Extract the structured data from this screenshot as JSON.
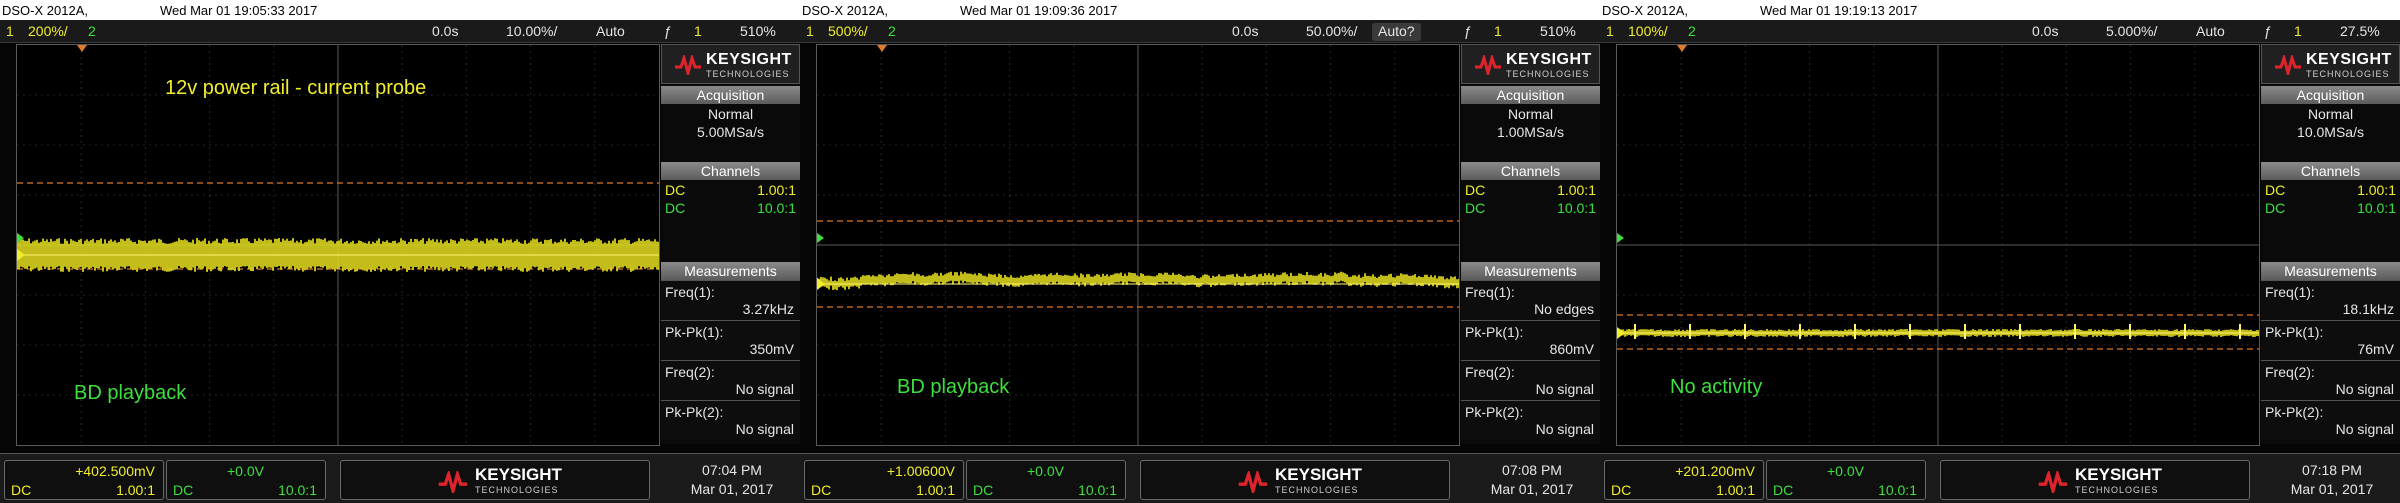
{
  "colors": {
    "ch1": "#f2ee2c",
    "ch2": "#3ce03c",
    "cursor": "#e07a2a",
    "keysight_red": "#e0242c"
  },
  "logo": {
    "brand": "KEYSIGHT",
    "sub": "TECHNOLOGIES"
  },
  "side_labels": {
    "acquisition": "Acquisition",
    "channels": "Channels",
    "measurements": "Measurements",
    "mode": "Normal",
    "dc": "DC",
    "ch1_ratio": "1.00:1",
    "ch2_ratio": "10.0:1"
  },
  "panels": [
    {
      "model": "DSO-X 2012A,",
      "datetime": "Wed Mar 01 19:05:33 2017",
      "ch1_num": "1",
      "ch1_scale": "200%/",
      "ch2_num": "2",
      "time_offset": "0.0s",
      "time_scale": "10.00%/",
      "trigger_mode": "Auto",
      "trig_icon": "ƒ",
      "trig_ch": "1",
      "trig_level": "510%",
      "sample_rate": "5.00MSa/s",
      "annotations": [
        {
          "text": "12v power rail - current probe",
          "color": "yellow"
        },
        {
          "text": "BD playback",
          "color": "green"
        }
      ],
      "measurements": [
        {
          "label": "Freq(1):",
          "value": "3.27kHz"
        },
        {
          "label": "Pk-Pk(1):",
          "value": "350mV"
        },
        {
          "label": "Freq(2):",
          "value": "No signal"
        },
        {
          "label": "Pk-Pk(2):",
          "value": "No signal"
        }
      ],
      "ch1_offset": "+402.500mV",
      "ch2_offset": "+0.0V",
      "clock_time": "07:04 PM",
      "clock_date": "Mar 01, 2017"
    },
    {
      "model": "DSO-X 2012A,",
      "datetime": "Wed Mar 01 19:09:36 2017",
      "ch1_num": "1",
      "ch1_scale": "500%/",
      "ch2_num": "2",
      "time_offset": "0.0s",
      "time_scale": "50.00%/",
      "trigger_mode": "Auto?",
      "trig_icon": "ƒ",
      "trig_ch": "1",
      "trig_level": "510%",
      "sample_rate": "1.00MSa/s",
      "annotations": [
        {
          "text": "BD playback",
          "color": "green"
        }
      ],
      "measurements": [
        {
          "label": "Freq(1):",
          "value": "No edges"
        },
        {
          "label": "Pk-Pk(1):",
          "value": "860mV"
        },
        {
          "label": "Freq(2):",
          "value": "No signal"
        },
        {
          "label": "Pk-Pk(2):",
          "value": "No signal"
        }
      ],
      "ch1_offset": "+1.00600V",
      "ch2_offset": "+0.0V",
      "clock_time": "07:08 PM",
      "clock_date": "Mar 01, 2017"
    },
    {
      "model": "DSO-X 2012A,",
      "datetime": "Wed Mar 01 19:19:13 2017",
      "ch1_num": "1",
      "ch1_scale": "100%/",
      "ch2_num": "2",
      "time_offset": "0.0s",
      "time_scale": "5.000%/",
      "trigger_mode": "Auto",
      "trig_icon": "ƒ",
      "trig_ch": "1",
      "trig_level": "27.5%",
      "sample_rate": "10.0MSa/s",
      "annotations": [
        {
          "text": "No activity",
          "color": "green"
        }
      ],
      "measurements": [
        {
          "label": "Freq(1):",
          "value": "18.1kHz"
        },
        {
          "label": "Pk-Pk(1):",
          "value": "76mV"
        },
        {
          "label": "Freq(2):",
          "value": "No signal"
        },
        {
          "label": "Pk-Pk(2):",
          "value": "No signal"
        }
      ],
      "ch1_offset": "+201.200mV",
      "ch2_offset": "+0.0V",
      "clock_time": "07:18 PM",
      "clock_date": "Mar 01, 2017"
    }
  ]
}
